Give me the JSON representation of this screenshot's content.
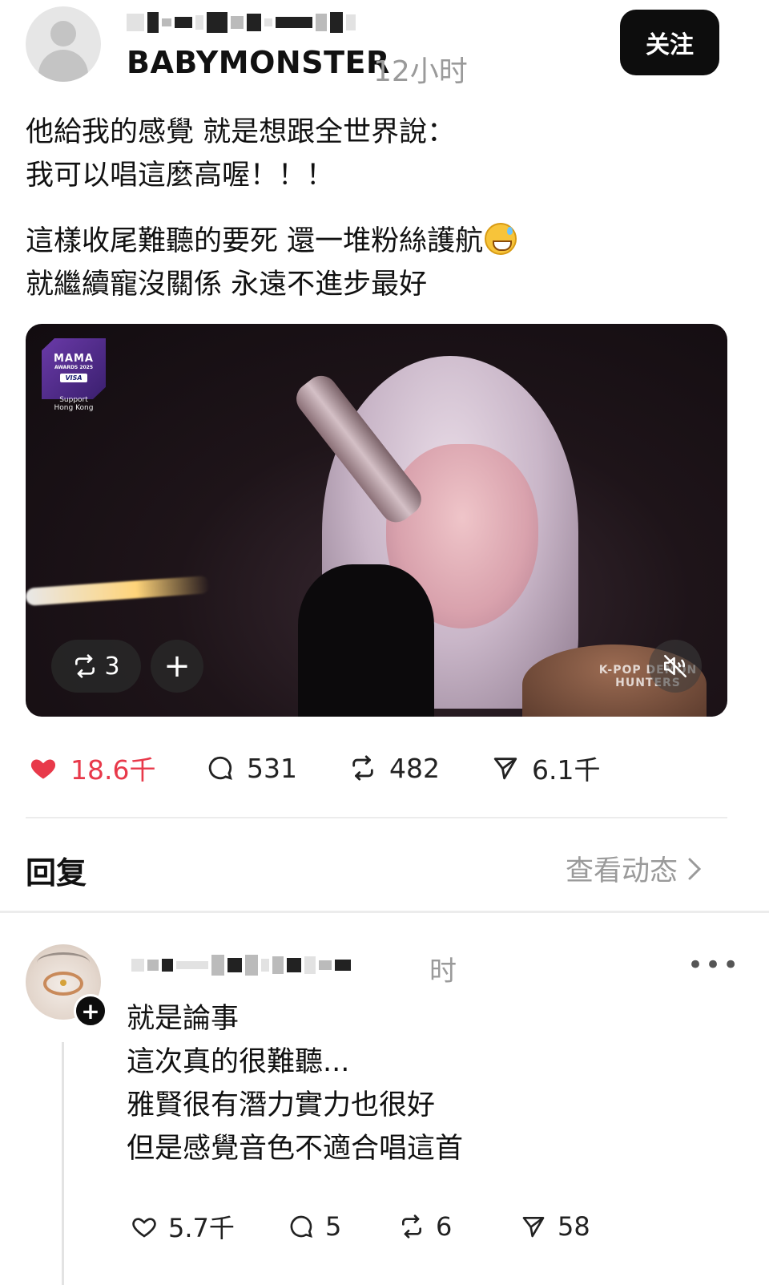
{
  "post": {
    "author_display": "BABYMONSTER",
    "time": "12小时",
    "follow_label": "关注",
    "text_lines": [
      "他給我的感覺 就是想跟全世界說：",
      "我可以唱這麼高喔！！！",
      "這樣收尾難聽的要死 還一堆粉絲護航",
      "就繼續寵沒關係 永遠不進步最好"
    ],
    "emoji_icon": "sweat-smile-emoji",
    "video": {
      "logo_text": "MAMA",
      "logo_subtext": "AWARDS 2025",
      "sponsor": "VISA",
      "support_text": "Support Hong Kong",
      "watermark_text": "K-POP DEMON HUNTERS",
      "repost_count": "3",
      "add_label": "+",
      "muted": true
    },
    "stats": {
      "likes": "18.6千",
      "comments": "531",
      "reposts": "482",
      "shares": "6.1千",
      "liked": true
    }
  },
  "replies_section": {
    "title": "回复",
    "view_activity": "查看动态"
  },
  "comment": {
    "time_suffix": "时",
    "text_lines": [
      "就是論事",
      "這次真的很難聽...",
      "雅賢很有潛力實力也很好",
      "但是感覺音色不適合唱這首"
    ],
    "stats": {
      "likes": "5.7千",
      "comments": "5",
      "reposts": "6",
      "shares": "58"
    }
  },
  "colors": {
    "like_red": "#e8394a",
    "muted_gray": "#9a9a9a",
    "button_black": "#0d0d0d"
  }
}
